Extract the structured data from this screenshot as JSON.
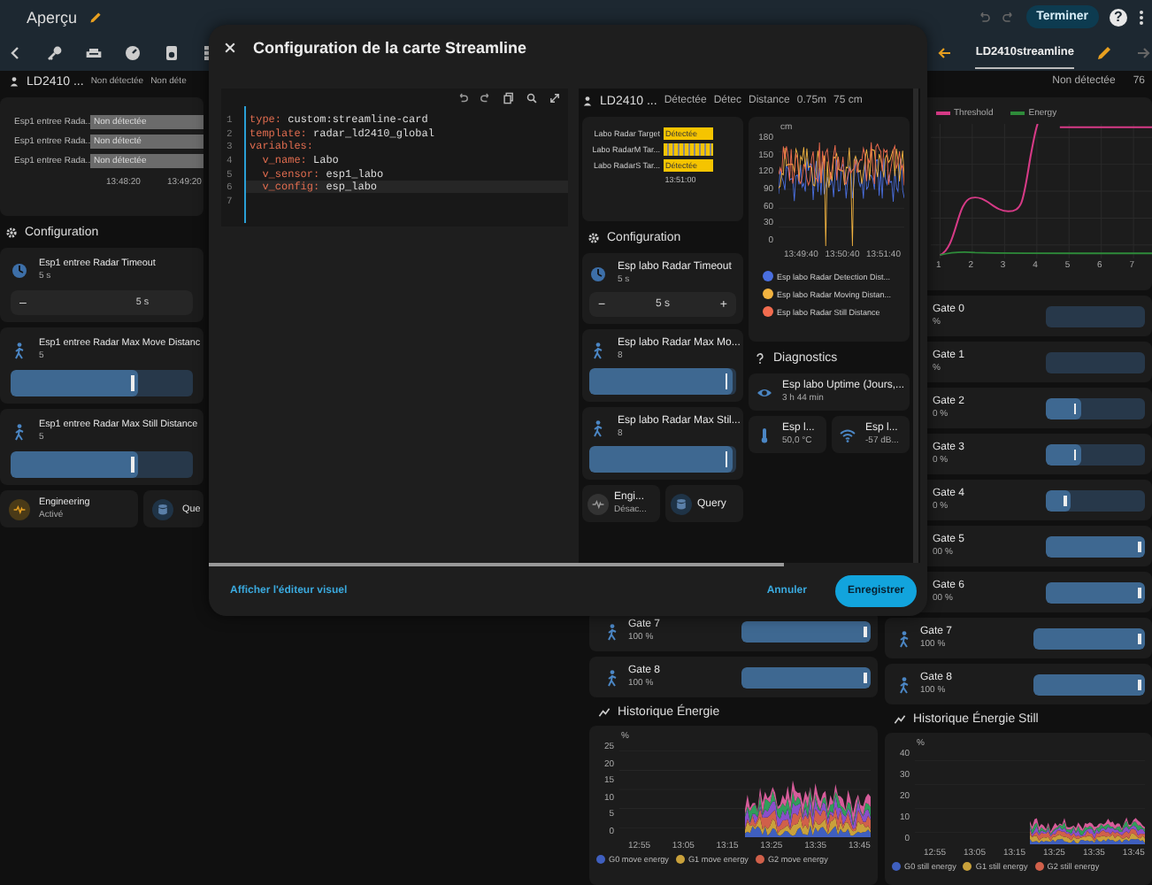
{
  "top_bar": {
    "title": "Aperçu",
    "done_button": "Terminer",
    "help": "?"
  },
  "tabs": [
    {
      "label": "LD2410streamline",
      "selected": true
    }
  ],
  "left_panel": {
    "header": {
      "title": "LD2410 ...",
      "statuses": [
        "Non détectée",
        "Non déte"
      ]
    },
    "timeline": {
      "rows": [
        {
          "label": "Esp1 entree Rada...",
          "state": "Non détectée"
        },
        {
          "label": "Esp1 entree Rada...",
          "state": "Non détecté"
        },
        {
          "label": "Esp1 entree Rada...",
          "state": "Non détectée"
        }
      ],
      "times": [
        "13:48:20",
        "13:49:20"
      ]
    },
    "section_title": "Configuration",
    "cards": [
      {
        "kind": "stepper",
        "name": "Esp1 entree Radar Timeout",
        "value": "5 s",
        "minus": "–",
        "control_value": "5 s"
      },
      {
        "kind": "slider",
        "name": "Esp1 entree Radar Max Move Distanc",
        "value": "5",
        "level": 0.7
      },
      {
        "kind": "slider",
        "name": "Esp1 entree Radar Max Still Distance",
        "value": "5",
        "level": 0.7
      }
    ],
    "buttons": [
      {
        "name": "Engineering",
        "state": "Activé",
        "on": true
      },
      {
        "name": "Que"
      }
    ]
  },
  "middle_panel": {
    "gates": [
      {
        "name": "Gate 7",
        "value": "100 %",
        "level": 1,
        "icon": true
      },
      {
        "name": "Gate 8",
        "value": "100 %",
        "level": 1,
        "icon": true
      }
    ],
    "chart": {
      "title": "Historique Énergie",
      "unit": "%",
      "y_ticks": [
        "25",
        "20",
        "15",
        "10",
        "5",
        "0"
      ],
      "x_ticks": [
        "12:55",
        "13:05",
        "13:15",
        "13:25",
        "13:35",
        "13:45"
      ],
      "legend": [
        {
          "label": "G0 move energy",
          "color": "#3f5fbf"
        },
        {
          "label": "G1 move energy",
          "color": "#c9a13b"
        },
        {
          "label": "G2 move energy",
          "color": "#d0604a"
        }
      ]
    }
  },
  "right_panel": {
    "statuses": [
      "Non détectée",
      "76"
    ],
    "threshold_chart": {
      "legend": [
        {
          "label": "Threshold",
          "color": "#d63a86"
        },
        {
          "label": "Energy",
          "color": "#2e8b3a"
        }
      ],
      "x_ticks": [
        "1",
        "2",
        "3",
        "4",
        "5",
        "6",
        "7"
      ]
    },
    "gates": [
      {
        "name": "Gate 0",
        "value": "%",
        "level": 0,
        "icon": false
      },
      {
        "name": "Gate 1",
        "value": "%",
        "level": 0,
        "icon": false
      },
      {
        "name": "Gate 2",
        "value": "0 %",
        "level": 0.35,
        "icon": false
      },
      {
        "name": "Gate 3",
        "value": "0 %",
        "level": 0.35,
        "icon": false
      },
      {
        "name": "Gate 4",
        "value": "0 %",
        "level": 0.25,
        "icon": false
      },
      {
        "name": "Gate 5",
        "value": "00 %",
        "level": 1,
        "icon": false
      },
      {
        "name": "Gate 6",
        "value": "00 %",
        "level": 1,
        "icon": false
      },
      {
        "name": "Gate 7",
        "value": "100 %",
        "level": 1,
        "icon": true
      },
      {
        "name": "Gate 8",
        "value": "100 %",
        "level": 1,
        "icon": true
      }
    ],
    "chart": {
      "title": "Historique Énergie Still",
      "unit": "%",
      "y_ticks": [
        "40",
        "30",
        "20",
        "10",
        "0"
      ],
      "x_ticks": [
        "12:55",
        "13:05",
        "13:15",
        "13:25",
        "13:35",
        "13:45"
      ],
      "legend": [
        {
          "label": "G0 still energy",
          "color": "#3f5fbf"
        },
        {
          "label": "G1 still energy",
          "color": "#c9a13b"
        },
        {
          "label": "G2 still energy",
          "color": "#d0604a"
        }
      ]
    }
  },
  "dialog": {
    "title": "Configuration de la carte Streamline",
    "code_lines": [
      {
        "number": "1",
        "text": "type: custom:streamline-card",
        "active": false
      },
      {
        "number": "2",
        "text": "template: radar_ld2410_global",
        "active": false
      },
      {
        "number": "3",
        "text": "variables:",
        "active": false
      },
      {
        "number": "4",
        "text": "  v_name: Labo",
        "active": false
      },
      {
        "number": "5",
        "text": "  v_sensor: esp1_labo",
        "active": false
      },
      {
        "number": "6",
        "text": "  v_config: esp_labo",
        "active": true
      },
      {
        "number": "7",
        "active": false
      }
    ],
    "preview": {
      "header": {
        "title": "LD2410 ...",
        "statuses": [
          "Détectée",
          "Détec",
          "Distance",
          "0.75m",
          "75 cm"
        ]
      },
      "targets": [
        {
          "label": "Labo Radar Target",
          "kind": "solid",
          "state": "Détectée"
        },
        {
          "label": "Labo RadarM Tar...",
          "kind": "striped"
        },
        {
          "label": "Labo RadarS Tar...",
          "kind": "solid",
          "state": "Détectée"
        }
      ],
      "time": "13:51:00",
      "section_title": "Configuration",
      "cards": [
        {
          "kind": "stepper",
          "name": "Esp labo Radar Timeout",
          "value": "5 s",
          "minus": "−",
          "control_value": "5 s",
          "plus": "+"
        },
        {
          "kind": "slider",
          "name": "Esp labo Radar Max Mo...",
          "value": "8",
          "level": 0.97
        },
        {
          "kind": "slider",
          "name": "Esp labo Radar Max Stil...",
          "value": "8",
          "level": 0.97
        }
      ],
      "buttons": [
        {
          "name": "Engi...",
          "state": "Désac...",
          "on": false
        },
        {
          "name": "Query"
        }
      ],
      "chart": {
        "unit": "cm",
        "y_ticks": [
          "180",
          "150",
          "120",
          "90",
          "60",
          "30",
          "0"
        ],
        "x_ticks": [
          "13:49:40",
          "13:50:40",
          "13:51:40"
        ],
        "legend": [
          {
            "label": "Esp labo Radar Detection Dist...",
            "color": "#4a6fe0"
          },
          {
            "label": "Esp labo Radar Moving Distan...",
            "color": "#f2b340"
          },
          {
            "label": "Esp labo Radar Still Distance",
            "color": "#f26c4f"
          }
        ]
      },
      "diagnostics_title": "Diagnostics",
      "diagnostics": [
        {
          "kind": "wide",
          "name": "Esp labo Uptime (Jours,...",
          "value": "3 h 44 min"
        },
        {
          "kind": "small",
          "name": "Esp l...",
          "value": "50,0 °C"
        },
        {
          "kind": "small",
          "name": "Esp l...",
          "value": "-57 dB..."
        }
      ]
    },
    "show_visual_editor": "Afficher l'éditeur visuel",
    "cancel": "Annuler",
    "save": "Enregistrer"
  }
}
